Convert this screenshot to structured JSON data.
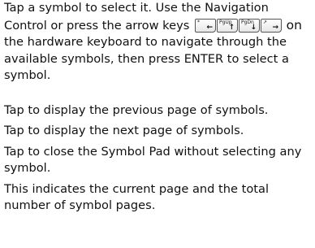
{
  "paragraphs": {
    "p1_part1": "Tap a symbol to select it. Use the Navigation Control or press the arrow keys",
    "p1_on": "on",
    "p1_part2": "the hardware keyboard to navigate through the available symbols, then press ENTER to select a symbol.",
    "p2": "Tap to display the previous page of symbols.",
    "p3": "Tap to display the next page of symbols.",
    "p4": "Tap to close the Symbol Pad without selecting any symbol.",
    "p5": "This indicates the current page and the total number of symbol pages."
  },
  "keys": [
    {
      "name": "left-arrow-key",
      "top": "*",
      "bottom": "←",
      "icon": "left-arrow-key-icon"
    },
    {
      "name": "page-up-key",
      "top": "PgUp",
      "bottom": "↑",
      "icon": "page-up-key-icon"
    },
    {
      "name": "page-down-key",
      "top": "PgDn",
      "bottom": "↓",
      "icon": "page-down-key-icon"
    },
    {
      "name": "right-arrow-key",
      "top": "↗",
      "bottom": "→",
      "icon": "right-arrow-key-icon"
    }
  ]
}
